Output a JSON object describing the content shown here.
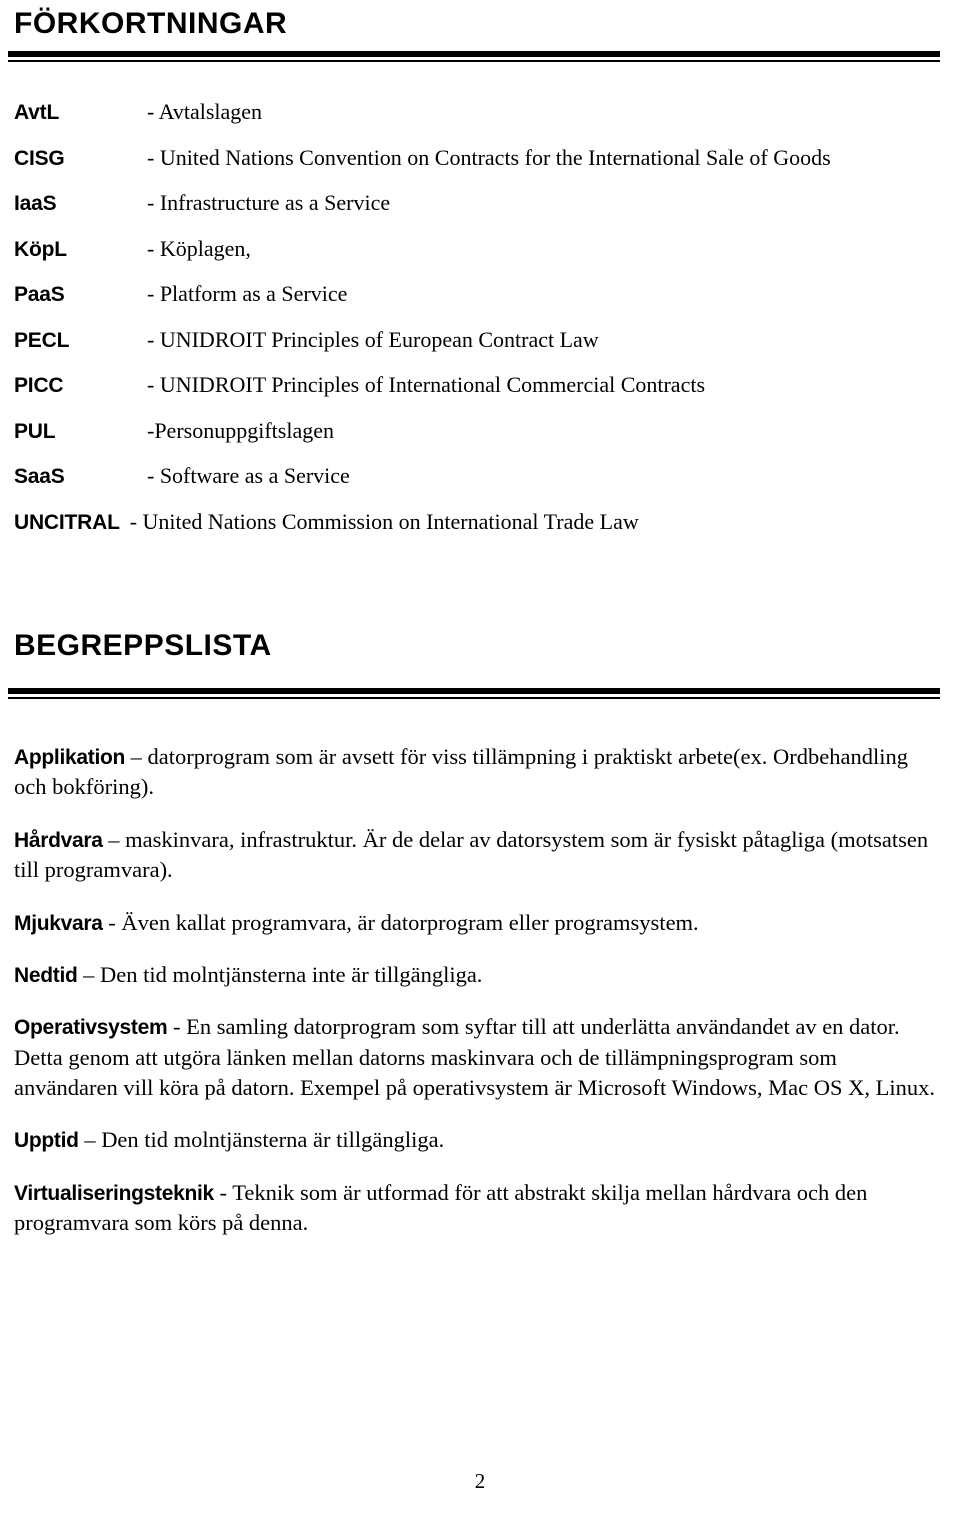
{
  "document": {
    "page_number": "2"
  },
  "abbreviations_section": {
    "heading": "FÖRKORTNINGAR",
    "entries": [
      {
        "term": "AvtL",
        "definition": "- Avtalslagen"
      },
      {
        "term": "CISG",
        "definition": "- United Nations Convention on Contracts for the International Sale of Goods"
      },
      {
        "term": "IaaS",
        "definition": "- Infrastructure as a Service"
      },
      {
        "term": "KöpL",
        "definition": "- Köplagen,"
      },
      {
        "term": "PaaS",
        "definition": "- Platform as a Service"
      },
      {
        "term": "PECL",
        "definition": "- UNIDROIT Principles of European Contract Law"
      },
      {
        "term": "PICC",
        "definition": "- UNIDROIT Principles of International Commercial Contracts"
      },
      {
        "term": "PUL",
        "definition": "-Personuppgiftslagen"
      },
      {
        "term": "SaaS",
        "definition": "- Software as a Service"
      },
      {
        "term": "UNCITRAL",
        "definition": "- United Nations Commission on International Trade Law"
      }
    ]
  },
  "glossary_section": {
    "heading": "BEGREPPSLISTA",
    "entries": [
      {
        "term": "Applikation",
        "body": " – datorprogram som är avsett för viss tillämpning i praktiskt arbete(ex. Ordbehandling och bokföring)."
      },
      {
        "term": "Hårdvara",
        "body": " – maskinvara, infrastruktur. Är de delar av datorsystem som är fysiskt påtagliga (motsatsen till programvara)."
      },
      {
        "term": "Mjukvara",
        "body": " - Även kallat programvara, är datorprogram eller programsystem."
      },
      {
        "term": "Nedtid",
        "body": " – Den tid molntjänsterna inte är tillgängliga."
      },
      {
        "term": "Operativsystem",
        "body": " - En samling datorprogram som syftar till att underlätta användandet av en dator. Detta genom att utgöra länken mellan datorns maskinvara och de tillämpningsprogram som användaren vill köra på datorn. Exempel på operativsystem är Microsoft Windows, Mac OS X, Linux."
      },
      {
        "term": "Upptid",
        "body": " – Den tid molntjänsterna är tillgängliga."
      },
      {
        "term": "Virtualiseringsteknik",
        "body": " - Teknik som är utformad för att abstrakt skilja mellan hårdvara och den programvara som körs på denna."
      }
    ]
  }
}
